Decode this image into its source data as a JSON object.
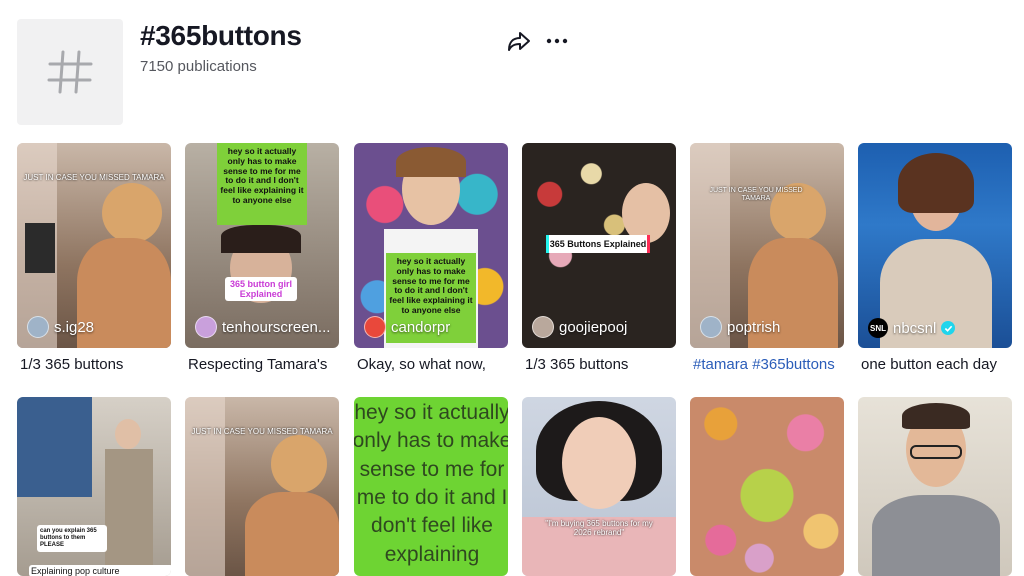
{
  "header": {
    "title": "#365buttons",
    "subtitle": "7150 publications",
    "hash_icon": "hashtag-icon",
    "share_icon": "share-icon",
    "more_icon": "more-dots-icon"
  },
  "videos_row1": [
    {
      "author": "s.ig28",
      "caption": "1/3 365 buttons",
      "overlay": "JUST IN CASE YOU MISSED TAMARA"
    },
    {
      "author": "tenhourscreen...",
      "caption": "Respecting Tamara's",
      "overlay": "hey so it actually only has to make sense to me for me to do it and I don't feel like explaining it to anyone else",
      "badge": "365 button girl Explained"
    },
    {
      "author": "candorpr",
      "caption": "Okay, so what now,",
      "overlay": "hey so it actually only has to make sense to me for me to do it and I don't feel like explaining it to anyone else"
    },
    {
      "author": "goojiepooj",
      "caption": "1/3 365 buttons",
      "overlay": "365 Buttons Explained"
    },
    {
      "author": "poptrish",
      "caption": "#tamara #365buttons",
      "overlay": "JUST IN CASE YOU MISSED TAMARA"
    },
    {
      "author": "nbcsnl",
      "caption": "one button each day",
      "logo": "SNL"
    }
  ],
  "videos_row2": [
    {
      "overlay": "can you explain 365 buttons to them PLEASE",
      "label": "Explaining pop culture"
    },
    {
      "overlay": "JUST IN CASE YOU MISSED TAMARA"
    },
    {
      "overlay": "hey so it actually only has to make sense to me for me to do it and I don't feel like explaining"
    },
    {
      "overlay": "\"I'm buying 365 buttons for my 2026 rebrand\""
    },
    {
      "overlay": ""
    },
    {
      "overlay": ""
    }
  ],
  "colors": {
    "accent": "#2b5db9",
    "text": "#161823",
    "muted": "#55575e"
  }
}
